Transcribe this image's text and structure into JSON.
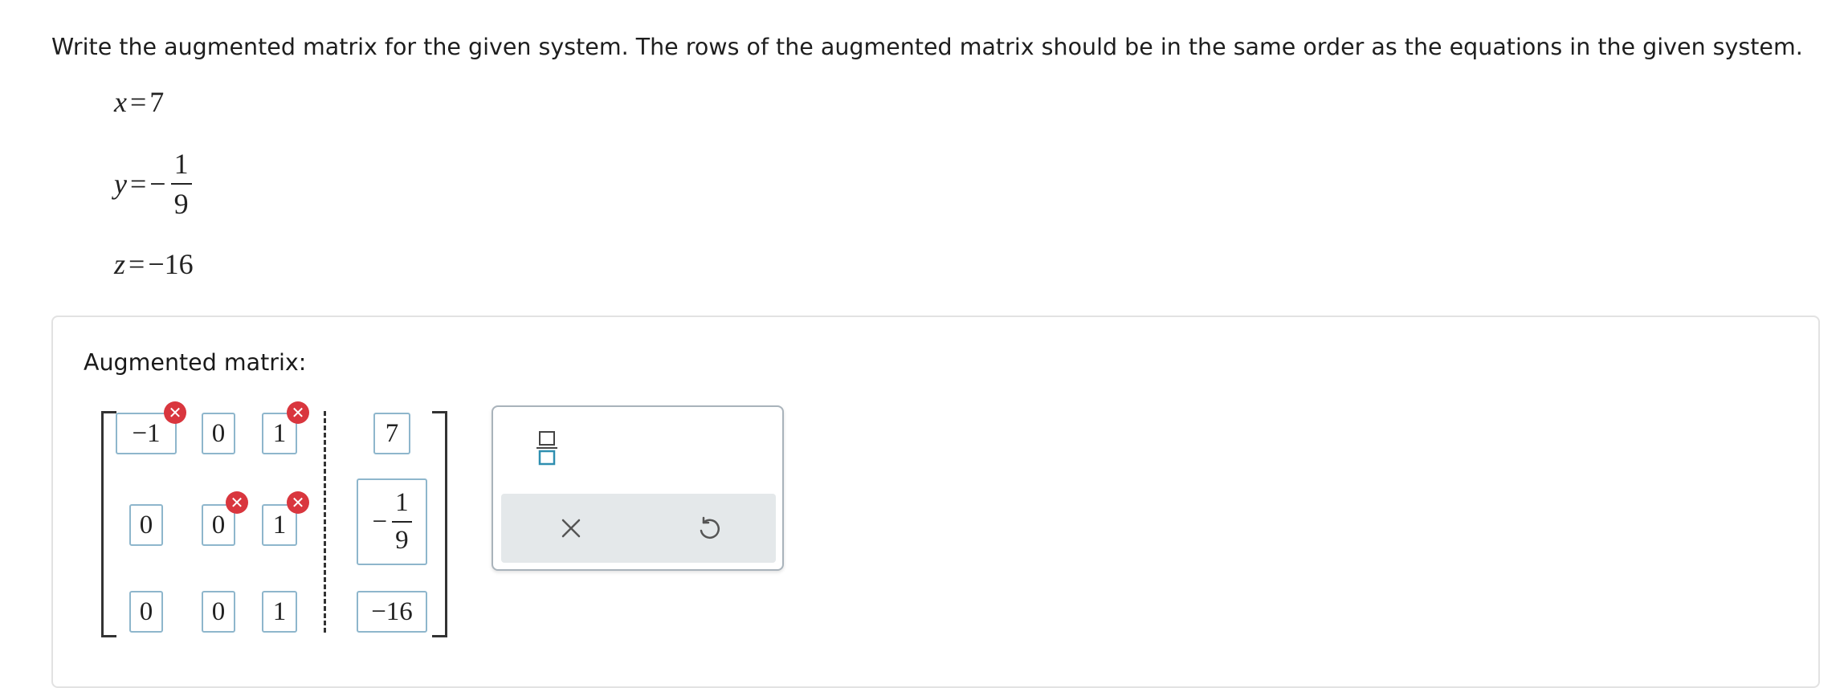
{
  "prompt": "Write the augmented matrix for the given system. The rows of the augmented matrix should be in the same order as the equations in the given system.",
  "system": {
    "eq1": {
      "var": "x",
      "eq": "=",
      "value": "7"
    },
    "eq2": {
      "var": "y",
      "eq": "=",
      "sign": "−",
      "num": "1",
      "den": "9"
    },
    "eq3": {
      "var": "z",
      "eq": "=",
      "value": "−16"
    }
  },
  "answer_panel": {
    "label": "Augmented matrix:",
    "matrix": {
      "r0": {
        "c0": "−1",
        "c1": "0",
        "c2": "1",
        "rhs": "7"
      },
      "r1": {
        "c0": "0",
        "c1": "0",
        "c2": "1",
        "rhs_sign": "−",
        "rhs_num": "1",
        "rhs_den": "9"
      },
      "r2": {
        "c0": "0",
        "c1": "0",
        "c2": "1",
        "rhs": "−16"
      }
    },
    "error_marks": [
      "r0c0",
      "r0c2",
      "r1c1",
      "r1c2"
    ],
    "error_glyph": "✕"
  },
  "toolbox": {
    "tools": [
      "fraction-icon"
    ],
    "actions": [
      "clear-icon",
      "undo-icon"
    ]
  },
  "colors": {
    "cell_border": "#8eb6cc",
    "error": "#d9363e",
    "fraction_tool": "#2f8fb0",
    "action_bg": "#e4e8ea"
  }
}
